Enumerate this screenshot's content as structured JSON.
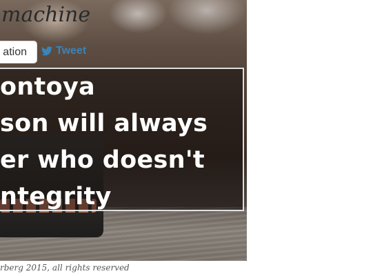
{
  "header": {
    "brand": "machine"
  },
  "actions": {
    "donate_label": "ation",
    "tweet_label": "Tweet",
    "tweet_icon": "twitter-bird-icon"
  },
  "quote": {
    "lines": [
      "ontoya",
      "son will always",
      "er who doesn't",
      "ntegrity"
    ]
  },
  "footer": {
    "text": "rberg 2015, all rights reserved"
  },
  "colors": {
    "tweet": "#3b84b8",
    "quote_text": "#ffffff"
  }
}
